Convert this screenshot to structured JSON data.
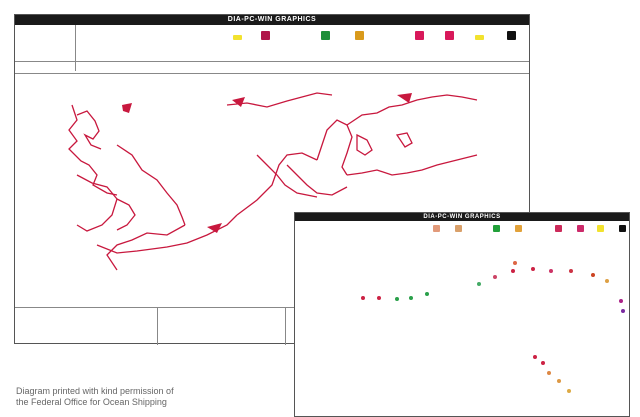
{
  "main_window": {
    "title": "DIA-PC-WIN GRAPHICS",
    "swatches": [
      "#f2e22e",
      "#b0164a",
      "#1e8f3a",
      "#d99a1c",
      "#d8185a",
      "#d8185a",
      "#f2e22e",
      "#111111"
    ]
  },
  "inset_window": {
    "title": "DIA-PC-WIN GRAPHICS",
    "swatches": [
      "#e29a7a",
      "#d9a06a",
      "#22a03a",
      "#e2a23a",
      "#cc2a5a",
      "#cc2a6a",
      "#f2e22e",
      "#111111"
    ]
  },
  "caption": {
    "line1": "Diagram printed with kind permission of",
    "line2": "the Federal Office for Ocean Shipping"
  },
  "map_color": "#c8183e"
}
